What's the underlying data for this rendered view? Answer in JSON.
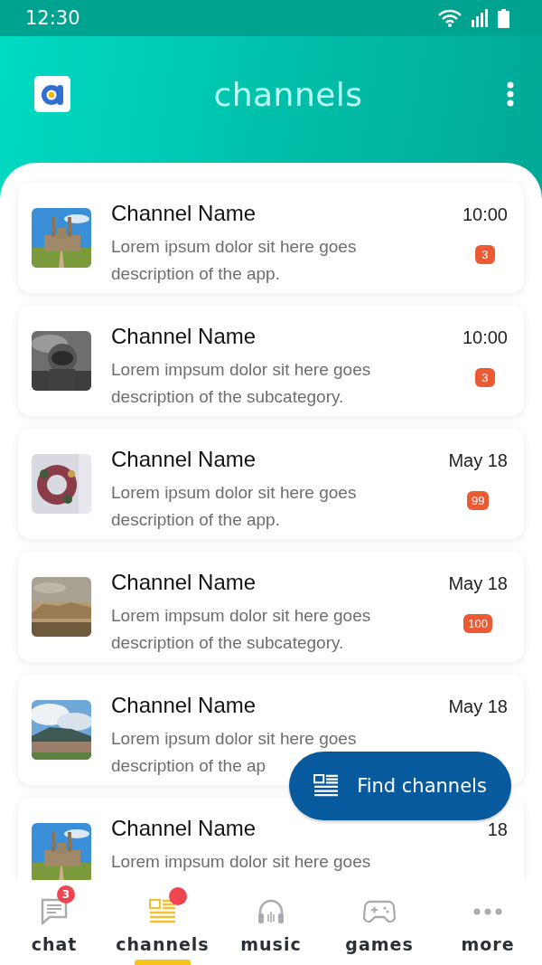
{
  "status_bar": {
    "time": "12:30"
  },
  "header": {
    "title": "channels"
  },
  "channels": [
    {
      "name": "Channel Name",
      "lines": [
        "Lorem ipsum dolor sit here goes",
        "description of the app."
      ],
      "time": "10:00",
      "unread": "3"
    },
    {
      "name": "Channel Name",
      "lines": [
        "Lorem impsum dolor sit here goes",
        "description of the subcategory."
      ],
      "time": "10:00",
      "unread": "3"
    },
    {
      "name": "Channel Name",
      "lines": [
        "Lorem ipsum dolor sit here goes",
        "description of the app."
      ],
      "time": "May 18",
      "unread": "99"
    },
    {
      "name": "Channel Name",
      "lines": [
        "Lorem impsum dolor sit here goes",
        "description of the subcategory."
      ],
      "time": "May 18",
      "unread": "100"
    },
    {
      "name": "Channel Name",
      "lines": [
        "Lorem ipsum dolor sit here goes",
        "description of the ap"
      ],
      "time": "May 18"
    },
    {
      "name": "Channel Name",
      "lines": [
        "Lorem impsum dolor sit here goes"
      ],
      "time": "18"
    }
  ],
  "fab": {
    "label": "Find channels"
  },
  "nav": [
    {
      "kind": "chat",
      "label": "chat",
      "selected": false,
      "badge": "3",
      "dot": false
    },
    {
      "kind": "channels",
      "label": "channels",
      "selected": true,
      "dot": true
    },
    {
      "kind": "music",
      "label": "music",
      "selected": false,
      "dot": false
    },
    {
      "kind": "games",
      "label": "games",
      "selected": false,
      "dot": false
    },
    {
      "kind": "more",
      "label": "more",
      "selected": false,
      "dot": false
    }
  ]
}
